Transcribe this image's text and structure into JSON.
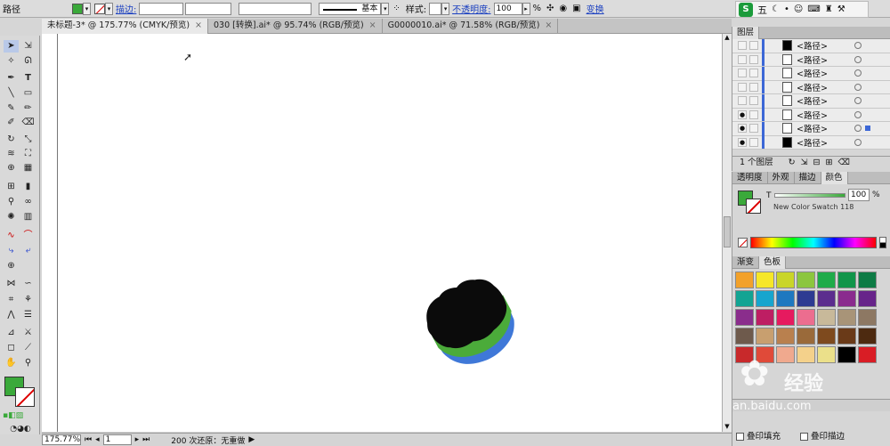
{
  "control_bar": {
    "object_type": "路径",
    "stroke_label": "描边:",
    "stroke_style": "基本",
    "style_label": "样式:",
    "opacity_label": "不透明度:",
    "opacity_value": "100",
    "opacity_unit": "%",
    "transform_link": "变换",
    "fill_color": "#3aa93a"
  },
  "ime": {
    "logo": "S",
    "mode": "五"
  },
  "tabs": [
    {
      "label": "未标题-3* @ 175.77% (CMYK/预览)",
      "active": true
    },
    {
      "label": "030 [转换].ai* @ 95.74% (RGB/预览)",
      "active": false
    },
    {
      "label": "G0000010.ai* @ 71.58% (RGB/预览)",
      "active": false
    }
  ],
  "status": {
    "zoom": "175.77%",
    "page": "1",
    "message": "200 次还原：无重做"
  },
  "layers": {
    "title": "图层",
    "rows": [
      {
        "name": "<路径>"
      },
      {
        "name": "<路径>"
      },
      {
        "name": "<路径>"
      },
      {
        "name": "<路径>"
      },
      {
        "name": "<路径>"
      },
      {
        "name": "<路径>"
      },
      {
        "name": "<路径>"
      },
      {
        "name": "<路径>"
      }
    ],
    "footer": "1 个图层"
  },
  "color_panel": {
    "tabs": [
      "透明度",
      "外观",
      "描边",
      "颜色"
    ],
    "channel": "T",
    "value": "100",
    "unit": "%",
    "swatch_name": "New Color Swatch 118"
  },
  "swatch_panel": {
    "tabs": [
      "渐变",
      "色板"
    ],
    "colors": [
      "#f2a12a",
      "#f6e728",
      "#c9d528",
      "#8cc63e",
      "#1fab4a",
      "#11954a",
      "#0d7b45",
      "#13a493",
      "#17a5ce",
      "#1e78c0",
      "#2d3b92",
      "#5b2d8e",
      "#8a2b8e",
      "#67248a",
      "#8a2d8c",
      "#be1e63",
      "#e61a5f",
      "#ec6d8f",
      "#c8b99a",
      "#a89478",
      "#8d7863",
      "#6e5a4c",
      "#c89f6f",
      "#b9804e",
      "#9a6a3a",
      "#7e4a1e",
      "#6a3a18",
      "#4d2a10",
      "#c8292b",
      "#e04a39",
      "#f0a98e",
      "#f4d18b",
      "#ebe08a",
      "#000000",
      "#d91d25"
    ]
  },
  "bottom_checks": {
    "fill": "叠印填充",
    "stroke": "叠印描边"
  },
  "watermark": {
    "site": "an.baidu.com",
    "brand": "经验"
  }
}
